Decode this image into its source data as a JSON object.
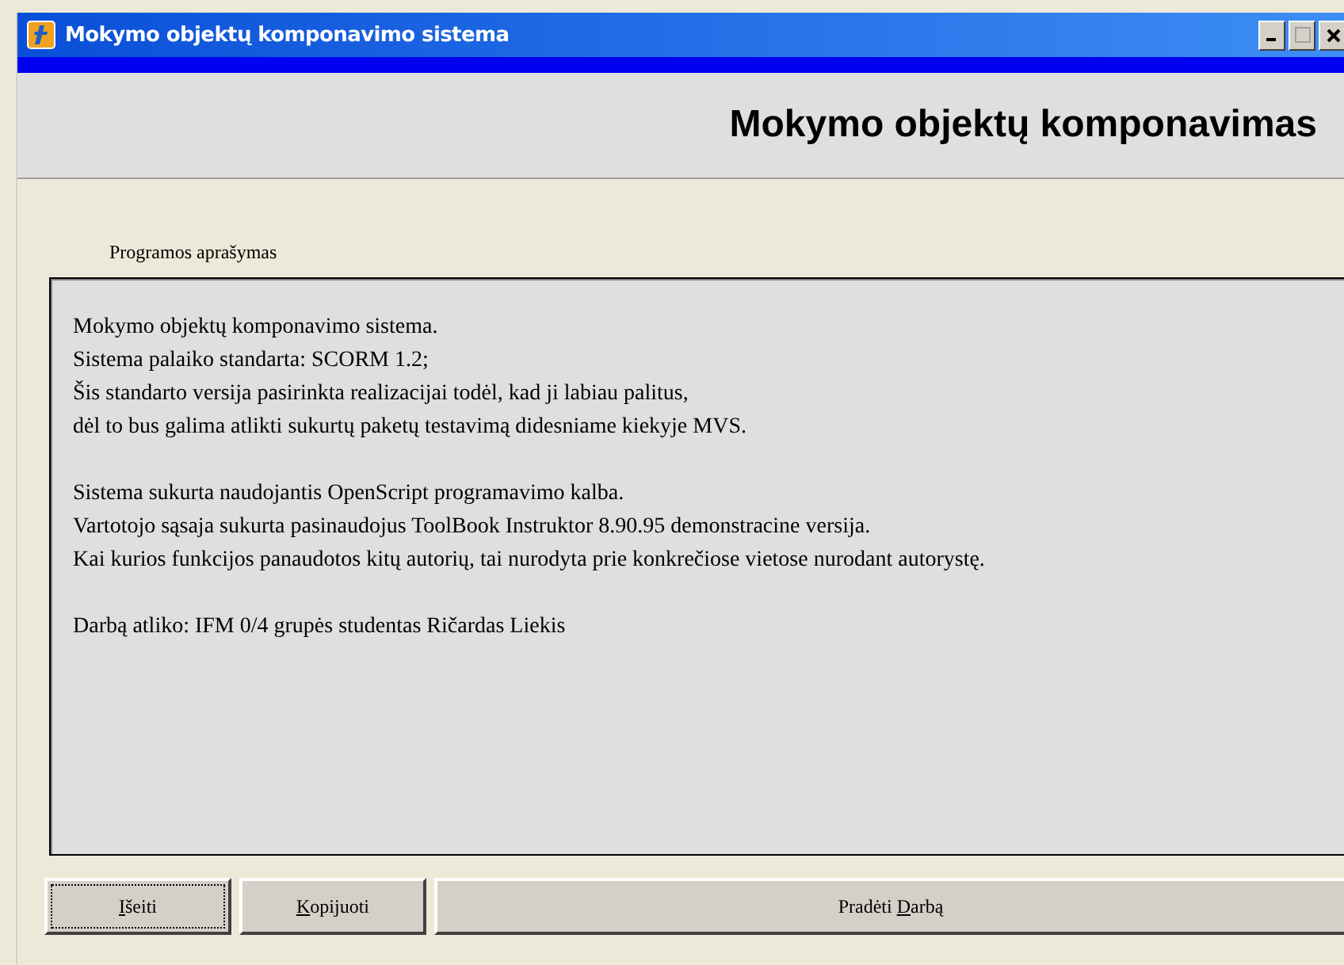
{
  "window": {
    "title": "Mokymo objektų komponavimo sistema",
    "maximize_disabled": true
  },
  "header": {
    "title": "Mokymo objektų komponavimas"
  },
  "section_label": "Programos aprašymas",
  "description": {
    "paragraphs": [
      [
        "Mokymo objektų komponavimo sistema.",
        "Sistema palaiko standarta: SCORM 1.2;",
        "Šis standarto versija pasirinkta realizacijai todėl, kad ji labiau palitus,",
        "dėl to bus galima atlikti sukurtų paketų testavimą didesniame kiekyje MVS."
      ],
      [
        "Sistema sukurta naudojantis OpenScript programavimo kalba.",
        "Vartotojo sąsaja sukurta pasinaudojus ToolBook Instruktor 8.90.95 demonstracine versija.",
        "Kai kurios funkcijos panaudotos kitų autorių, tai nurodyta prie konkrečiose vietose nurodant autorystę."
      ],
      [
        "Darbą atliko: IFM 0/4 grupės studentas Ričardas Liekis"
      ]
    ]
  },
  "buttons": [
    {
      "access_key": "I",
      "label_after": "šeiti",
      "focused": true,
      "kind": "small"
    },
    {
      "access_key": "K",
      "label_after": "opijuoti",
      "focused": false,
      "kind": "small"
    },
    {
      "label_before": "Pradėti ",
      "access_key": "D",
      "label_after": "arbą",
      "focused": false,
      "kind": "wide"
    }
  ]
}
